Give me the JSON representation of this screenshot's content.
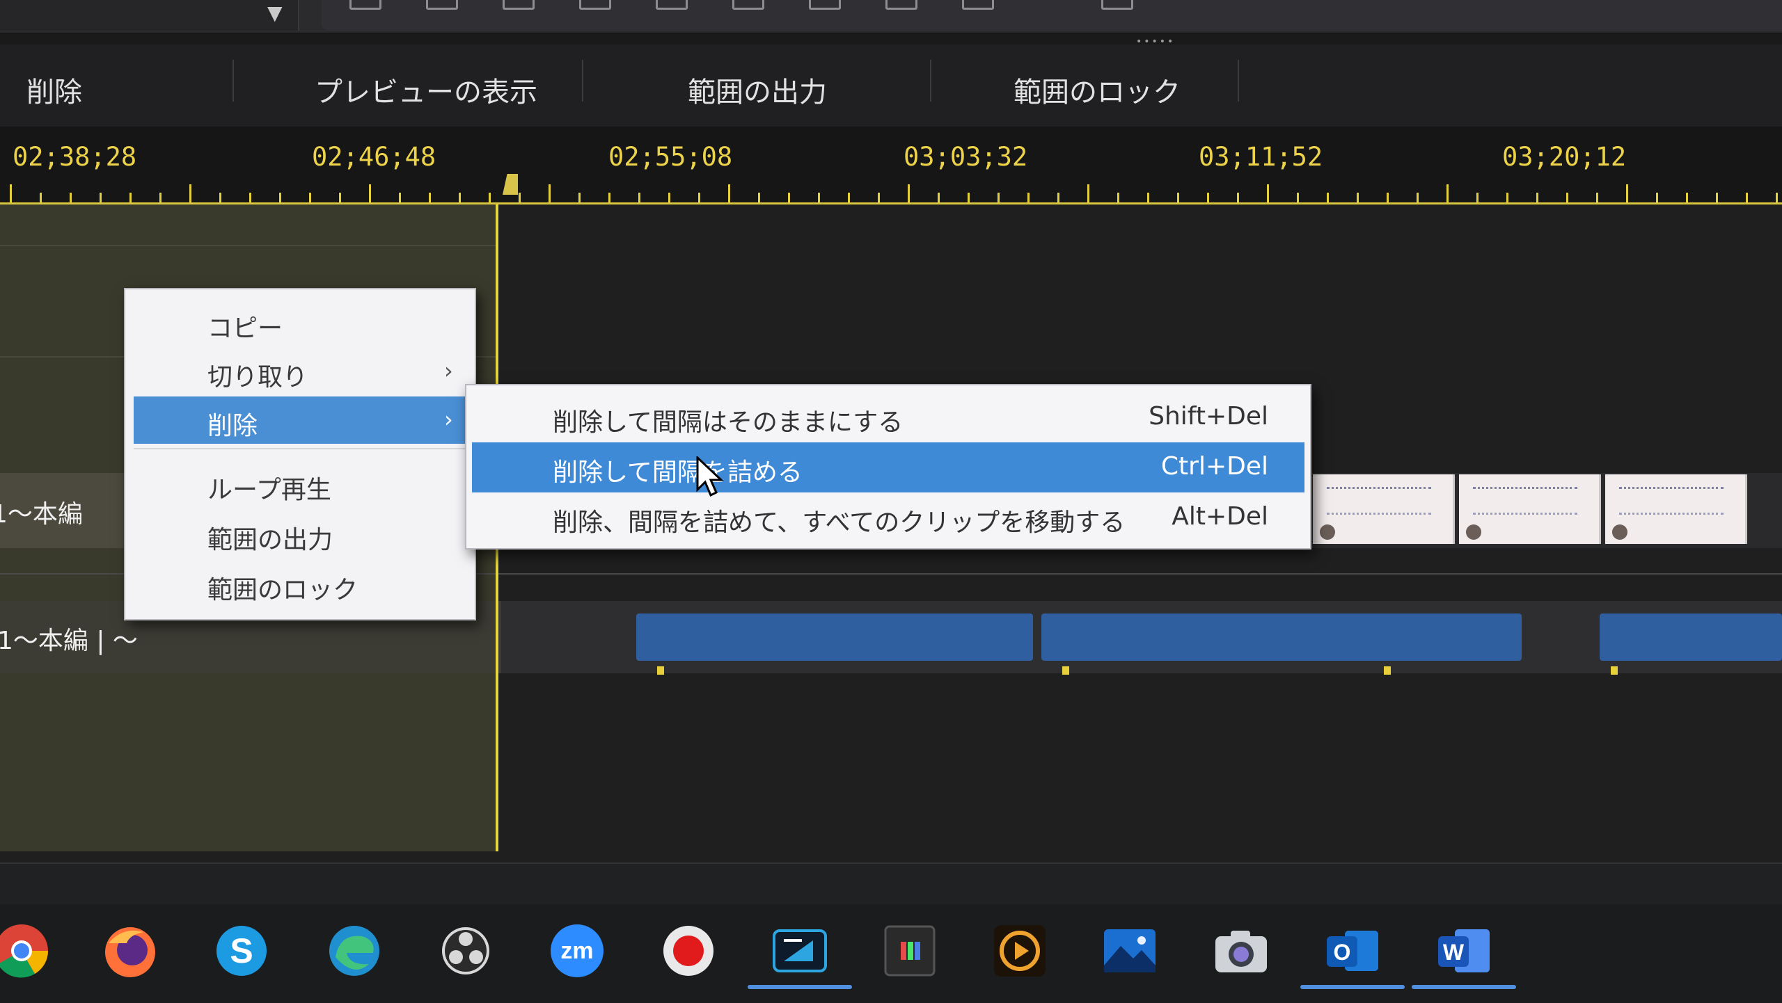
{
  "action_bar": {
    "delete": "削除",
    "show_preview": "プレビューの表示",
    "output_range": "範囲の出力",
    "lock_range": "範囲のロック"
  },
  "ruler": {
    "timecodes": [
      "02;38;28",
      "02;46;48",
      "02;55;08",
      "03;03;32",
      "03;11;52",
      "03;20;12"
    ]
  },
  "tracks": {
    "video_clip_label": "1～本編",
    "audio_clip_label": "1～本編 | ～"
  },
  "context_menu": {
    "items": [
      {
        "label": "コピー",
        "has_submenu": false
      },
      {
        "label": "切り取り",
        "has_submenu": true
      },
      {
        "label": "削除",
        "has_submenu": true,
        "active": true
      },
      {
        "label": "ループ再生",
        "has_submenu": false
      },
      {
        "label": "範囲の出力",
        "has_submenu": false
      },
      {
        "label": "範囲のロック",
        "has_submenu": false
      }
    ],
    "chevron": "›"
  },
  "delete_submenu": {
    "items": [
      {
        "label": "削除して間隔はそのままにする",
        "shortcut": "Shift+Del"
      },
      {
        "label": "削除して間隔を詰める",
        "shortcut": "Ctrl+Del",
        "active": true
      },
      {
        "label": "削除、間隔を詰めて、すべてのクリップを移動する",
        "shortcut": "Alt+Del"
      }
    ]
  },
  "taskbar": {
    "apps": [
      "chrome-icon",
      "firefox-icon",
      "skype-icon",
      "edge-icon",
      "obs-icon",
      "zoom-icon",
      "recorder-icon",
      "video-editor-icon",
      "colordirector-icon",
      "audiodirector-icon",
      "photo-editor-icon",
      "camera-icon",
      "outlook-icon",
      "word-icon"
    ],
    "zoom_label": "zm",
    "outlook_label": "O",
    "word_label": "W"
  },
  "colors": {
    "selection_blue": "#3f8ad6",
    "timecode_yellow": "#ecd34a",
    "waveform_blue": "#2f5f9e"
  }
}
